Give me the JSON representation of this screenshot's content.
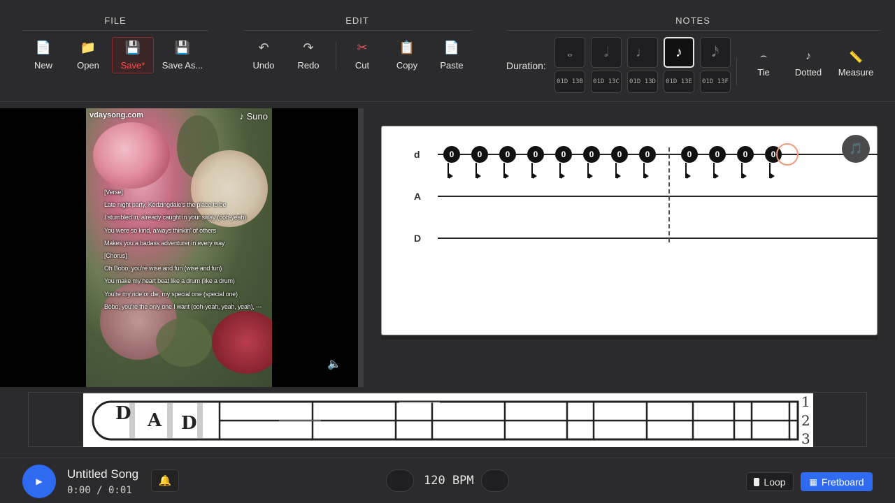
{
  "toolbar": {
    "groups": {
      "file": "FILE",
      "edit": "EDIT",
      "notes": "NOTES"
    },
    "file": {
      "new": "New",
      "open": "Open",
      "save": "Save*",
      "save_as": "Save As..."
    },
    "edit": {
      "undo": "Undo",
      "redo": "Redo",
      "cut": "Cut",
      "copy": "Copy",
      "paste": "Paste"
    },
    "notes": {
      "duration_label": "Duration:",
      "durations": [
        "whole",
        "half",
        "quarter",
        "eighth",
        "sixteenth"
      ],
      "active_duration": "eighth",
      "duration_codes": [
        "01D 13B",
        "01D 13C",
        "01D 13D",
        "01D 13E",
        "01D 13F"
      ],
      "tie": "Tie",
      "dotted": "Dotted",
      "measure": "Measure"
    }
  },
  "video": {
    "watermark": "vdaysong.com",
    "brand": "Suno",
    "lyrics": [
      "[Verse]",
      "Late night party, Kedzingdale's the place to be",
      "I stumbled in, already caught in your sway (ooh-yeah)",
      "You were so kind, always thinkin' of others",
      "Makes you a badass adventurer in every way",
      "[Chorus]",
      "Oh Bobo, you're wise and fun (wise and fun)",
      "You make my heart beat like a drum (like a drum)",
      "You're my ride or die, my special one (special one)",
      "Bobo, you're the only one I want (ooh-yeah, yeah, yeah), ---"
    ]
  },
  "tab": {
    "strings": [
      "d",
      "A",
      "D"
    ],
    "notes_string_d": [
      "0",
      "0",
      "0",
      "0",
      "0",
      "0",
      "0",
      "0",
      "0",
      "0",
      "0",
      "0"
    ]
  },
  "fretboard_strip": {
    "string_numbers": [
      "1",
      "2",
      "3"
    ],
    "clef_letters": [
      "D",
      "A",
      "D"
    ]
  },
  "player": {
    "title": "Untitled Song",
    "time": "0:00 / 0:01",
    "bpm": "120 BPM",
    "loop": "Loop",
    "fretboard": "Fretboard"
  }
}
